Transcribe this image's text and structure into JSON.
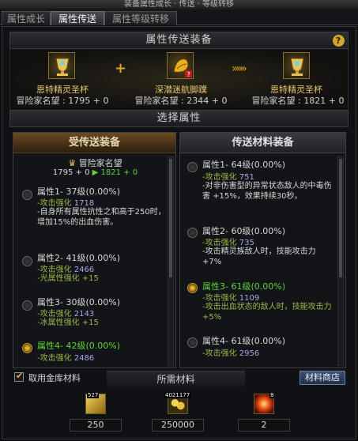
{
  "window": {
    "title": "装备属性成长 · 传送 · 等级转移"
  },
  "tabs": [
    {
      "label": "属性成长",
      "active": false
    },
    {
      "label": "属性传送",
      "active": true
    },
    {
      "label": "属性等级转移",
      "active": false
    }
  ],
  "transfer_section": {
    "title": "属性传送装备",
    "help_label": "?"
  },
  "items": {
    "source": {
      "name": "恩特精灵圣杯",
      "fame": "冒险家名望 : 1795 + 0",
      "icon": "chalice-icon"
    },
    "material": {
      "name": "深潜迷航脚蹼",
      "fame": "冒险家名望 : 2344 + 0",
      "icon": "flipper-icon"
    },
    "result": {
      "name": "恩特精灵圣杯",
      "fame": "冒险家名望 : 1821 + 0",
      "icon": "chalice-icon"
    }
  },
  "symbols": {
    "plus": "+",
    "arrows": "»»»"
  },
  "select_section": {
    "title": "选择属性"
  },
  "left_panel": {
    "header": "受传送装备",
    "fame_label": "冒险家名望",
    "fame_from": "1795 + 0",
    "fame_arrow": "▶",
    "fame_to": "1821 + 0",
    "attributes": [
      {
        "title": "属性1- 37级(0.00%)",
        "stat_label": "-攻击强化",
        "stat_value": "1718",
        "desc": "-自身所有属性抗性之和高于250时，增加15%的出血伤害。",
        "selected": false
      },
      {
        "title": "属性2- 41级(0.00%)",
        "stat_label": "-攻击强化",
        "stat_value": "2466",
        "desc": "-光属性强化 +15",
        "selected": false
      },
      {
        "title": "属性3- 30级(0.00%)",
        "stat_label": "-攻击强化",
        "stat_value": "2143",
        "desc": "-冰属性强化 +15",
        "selected": false
      },
      {
        "title": "属性4- 42级(0.00%)",
        "stat_label": "-攻击强化",
        "stat_value": "2486",
        "desc": "",
        "selected": true
      }
    ]
  },
  "right_panel": {
    "header": "传送材料装备",
    "attributes": [
      {
        "title": "属性1- 64级(0.00%)",
        "stat_label": "-攻击强化",
        "stat_value": "751",
        "desc": "-对非伤害型的异常状态敌人的中毒伤害 +15%，效果持续30秒。",
        "selected": false
      },
      {
        "title": "属性2- 60级(0.00%)",
        "stat_label": "-攻击强化",
        "stat_value": "735",
        "desc": "-攻击精灵族敌人时，技能攻击力 +7%",
        "selected": false
      },
      {
        "title": "属性3- 61级(0.00%)",
        "stat_label": "-攻击强化",
        "stat_value": "1109",
        "desc": "-攻击出血状态的敌人时，技能攻击力 +5%",
        "selected": true
      },
      {
        "title": "属性4- 61级(0.00%)",
        "stat_label": "-攻击强化",
        "stat_value": "2956",
        "desc": "",
        "selected": false
      }
    ]
  },
  "footer": {
    "use_storage_label": "取用金库材料",
    "use_storage_checked": true,
    "materials_title": "所需材料",
    "shop_button": "材料商店",
    "materials": [
      {
        "icon": "gold-bar-icon",
        "stock": "527",
        "required": "250",
        "color": "#c9a020"
      },
      {
        "icon": "gold-coins-icon",
        "stock": "4021177",
        "required": "250000",
        "color": "#b8902a"
      },
      {
        "icon": "fire-orb-icon",
        "stock": "8",
        "required": "2",
        "color": "#c8401a"
      }
    ]
  },
  "colors": {
    "selected_green": "#5ed23c",
    "gold": "#e9c873",
    "stat_value": "#a9a6e8"
  }
}
